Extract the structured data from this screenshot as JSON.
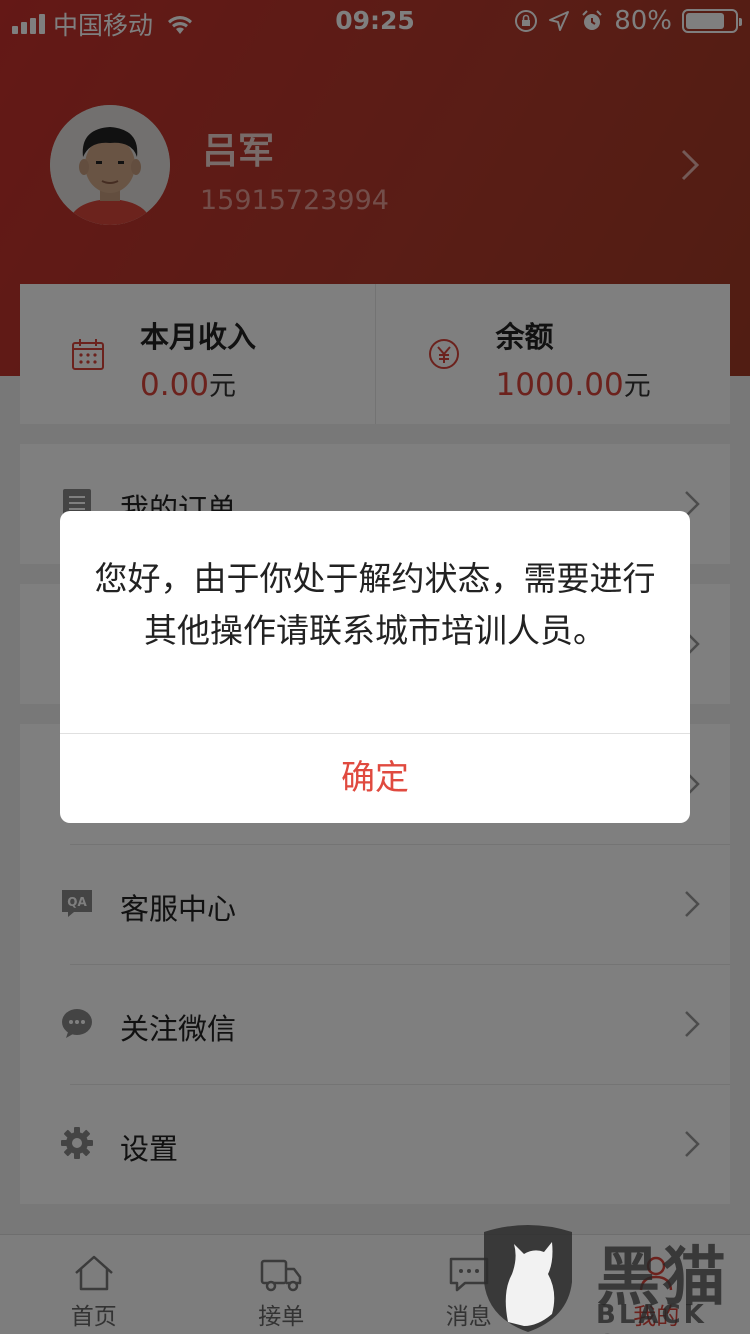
{
  "status_bar": {
    "carrier": "中国移动",
    "time": "09:25",
    "battery_percent": "80%",
    "battery_level": 0.8
  },
  "profile": {
    "name": "吕军",
    "phone": "15915723994"
  },
  "stats": {
    "monthly_income": {
      "title": "本月收入",
      "value": "0.00",
      "unit": "元"
    },
    "balance": {
      "title": "余额",
      "value": "1000.00",
      "unit": "元"
    }
  },
  "menu": {
    "my_orders": "我的订单",
    "customer_service": "客服中心",
    "follow_wechat": "关注微信",
    "settings": "设置"
  },
  "dialog": {
    "message": "您好，由于你处于解约状态，需要进行其他操作请联系城市培训人员。",
    "confirm": "确定"
  },
  "tabs": [
    {
      "label": "首页",
      "icon": "home-icon"
    },
    {
      "label": "接单",
      "icon": "truck-icon"
    },
    {
      "label": "消息",
      "icon": "message-icon"
    },
    {
      "label": "我的",
      "icon": "profile-icon"
    }
  ],
  "watermark": {
    "text": "黑猫",
    "sub": "BLACK CAT"
  },
  "colors": {
    "header": "#c8312d",
    "accent": "#d9443b",
    "dialog_button": "#e04a3f"
  }
}
